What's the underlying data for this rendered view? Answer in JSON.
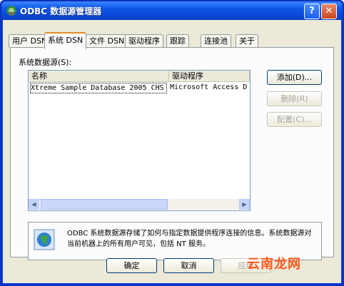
{
  "window": {
    "title": "ODBC 数据源管理器",
    "help_label": "?",
    "close_label": "✕"
  },
  "tabs": [
    {
      "label": "用户 DSN"
    },
    {
      "label": "系统 DSN"
    },
    {
      "label": "文件 DSN"
    },
    {
      "label": "驱动程序"
    },
    {
      "label": "跟踪"
    },
    {
      "label": "连接池"
    },
    {
      "label": "关于"
    }
  ],
  "system_dsn": {
    "label": "系统数据源(S):",
    "columns": {
      "name": "名称",
      "driver": "驱动程序"
    },
    "rows": [
      {
        "name": "Xtreme Sample Database 2005 CHS",
        "driver": "Microsoft Access D"
      }
    ]
  },
  "side_buttons": {
    "add": "添加(D)...",
    "remove": "删除(R)",
    "configure": "配置(C)..."
  },
  "info_text": "ODBC 系统数据源存储了如何与指定数据提供程序连接的信息。系统数据源对当前机器上的所有用户可见，包括 NT 服务。",
  "footer": {
    "ok": "确定",
    "cancel": "取消",
    "apply": "应用"
  },
  "watermark": "云南龙网"
}
